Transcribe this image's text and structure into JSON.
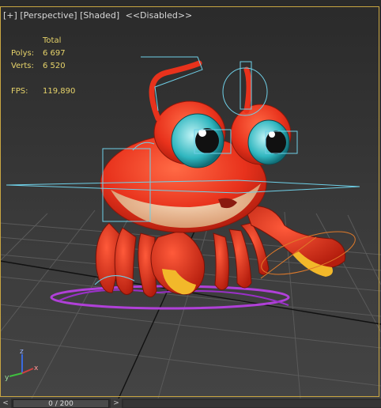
{
  "viewport": {
    "labels": {
      "plus": "[+]",
      "view": "[Perspective]",
      "shading": "[Shaded]",
      "extra": "<<Disabled>>"
    },
    "stats": {
      "header": "Total",
      "polys_label": "Polys:",
      "polys_value": "6 697",
      "verts_label": "Verts:",
      "verts_value": "6 520",
      "fps_label": "FPS:",
      "fps_value": "119,890"
    },
    "axis_labels": {
      "x": "x",
      "y": "y",
      "z": "z"
    },
    "colors": {
      "border": "#c9a642",
      "stats_text": "#e6d36a",
      "crab_body": "#e8321c",
      "rig_lines": "#6fd0e8",
      "selection": "#b040d8"
    }
  },
  "timeline": {
    "prev": "<",
    "frame_display": "0 / 200",
    "next": ">"
  }
}
